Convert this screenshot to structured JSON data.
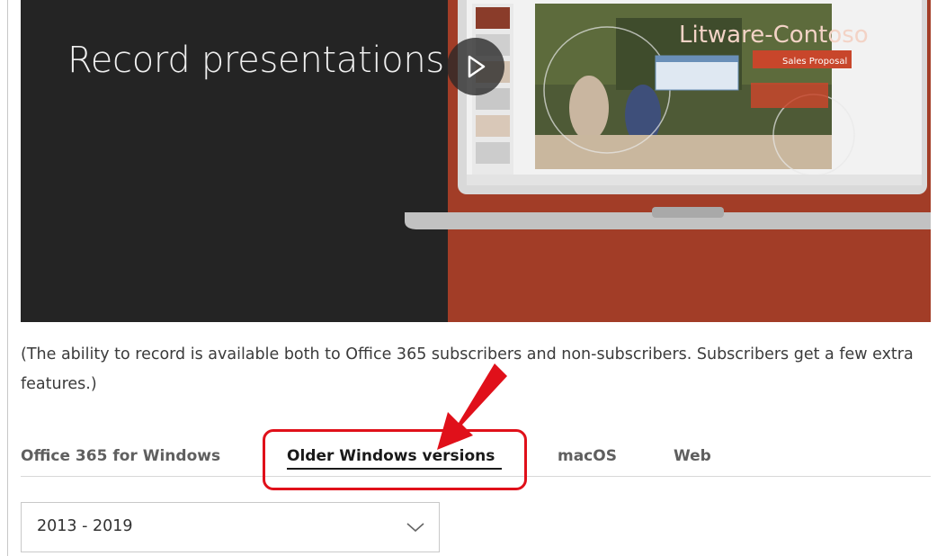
{
  "hero": {
    "title": "Record presentations",
    "slide_title": "Litware-Contoso",
    "slide_subtitle": "Sales Proposal",
    "play_icon": "play-icon"
  },
  "caption": {
    "text": "(The ability to record is available both to Office 365 subscribers and non-subscribers. Subscribers get a few extra features.)"
  },
  "tabs": {
    "items": [
      {
        "label": "Office 365 for Windows",
        "active": false
      },
      {
        "label": "Older Windows versions",
        "active": true
      },
      {
        "label": "macOS",
        "active": false
      },
      {
        "label": "Web",
        "active": false
      }
    ]
  },
  "version_select": {
    "selected": "2013 - 2019"
  },
  "colors": {
    "hero_dark": "#242424",
    "hero_orange": "#a23d27",
    "annotation_red": "#e0101a"
  }
}
